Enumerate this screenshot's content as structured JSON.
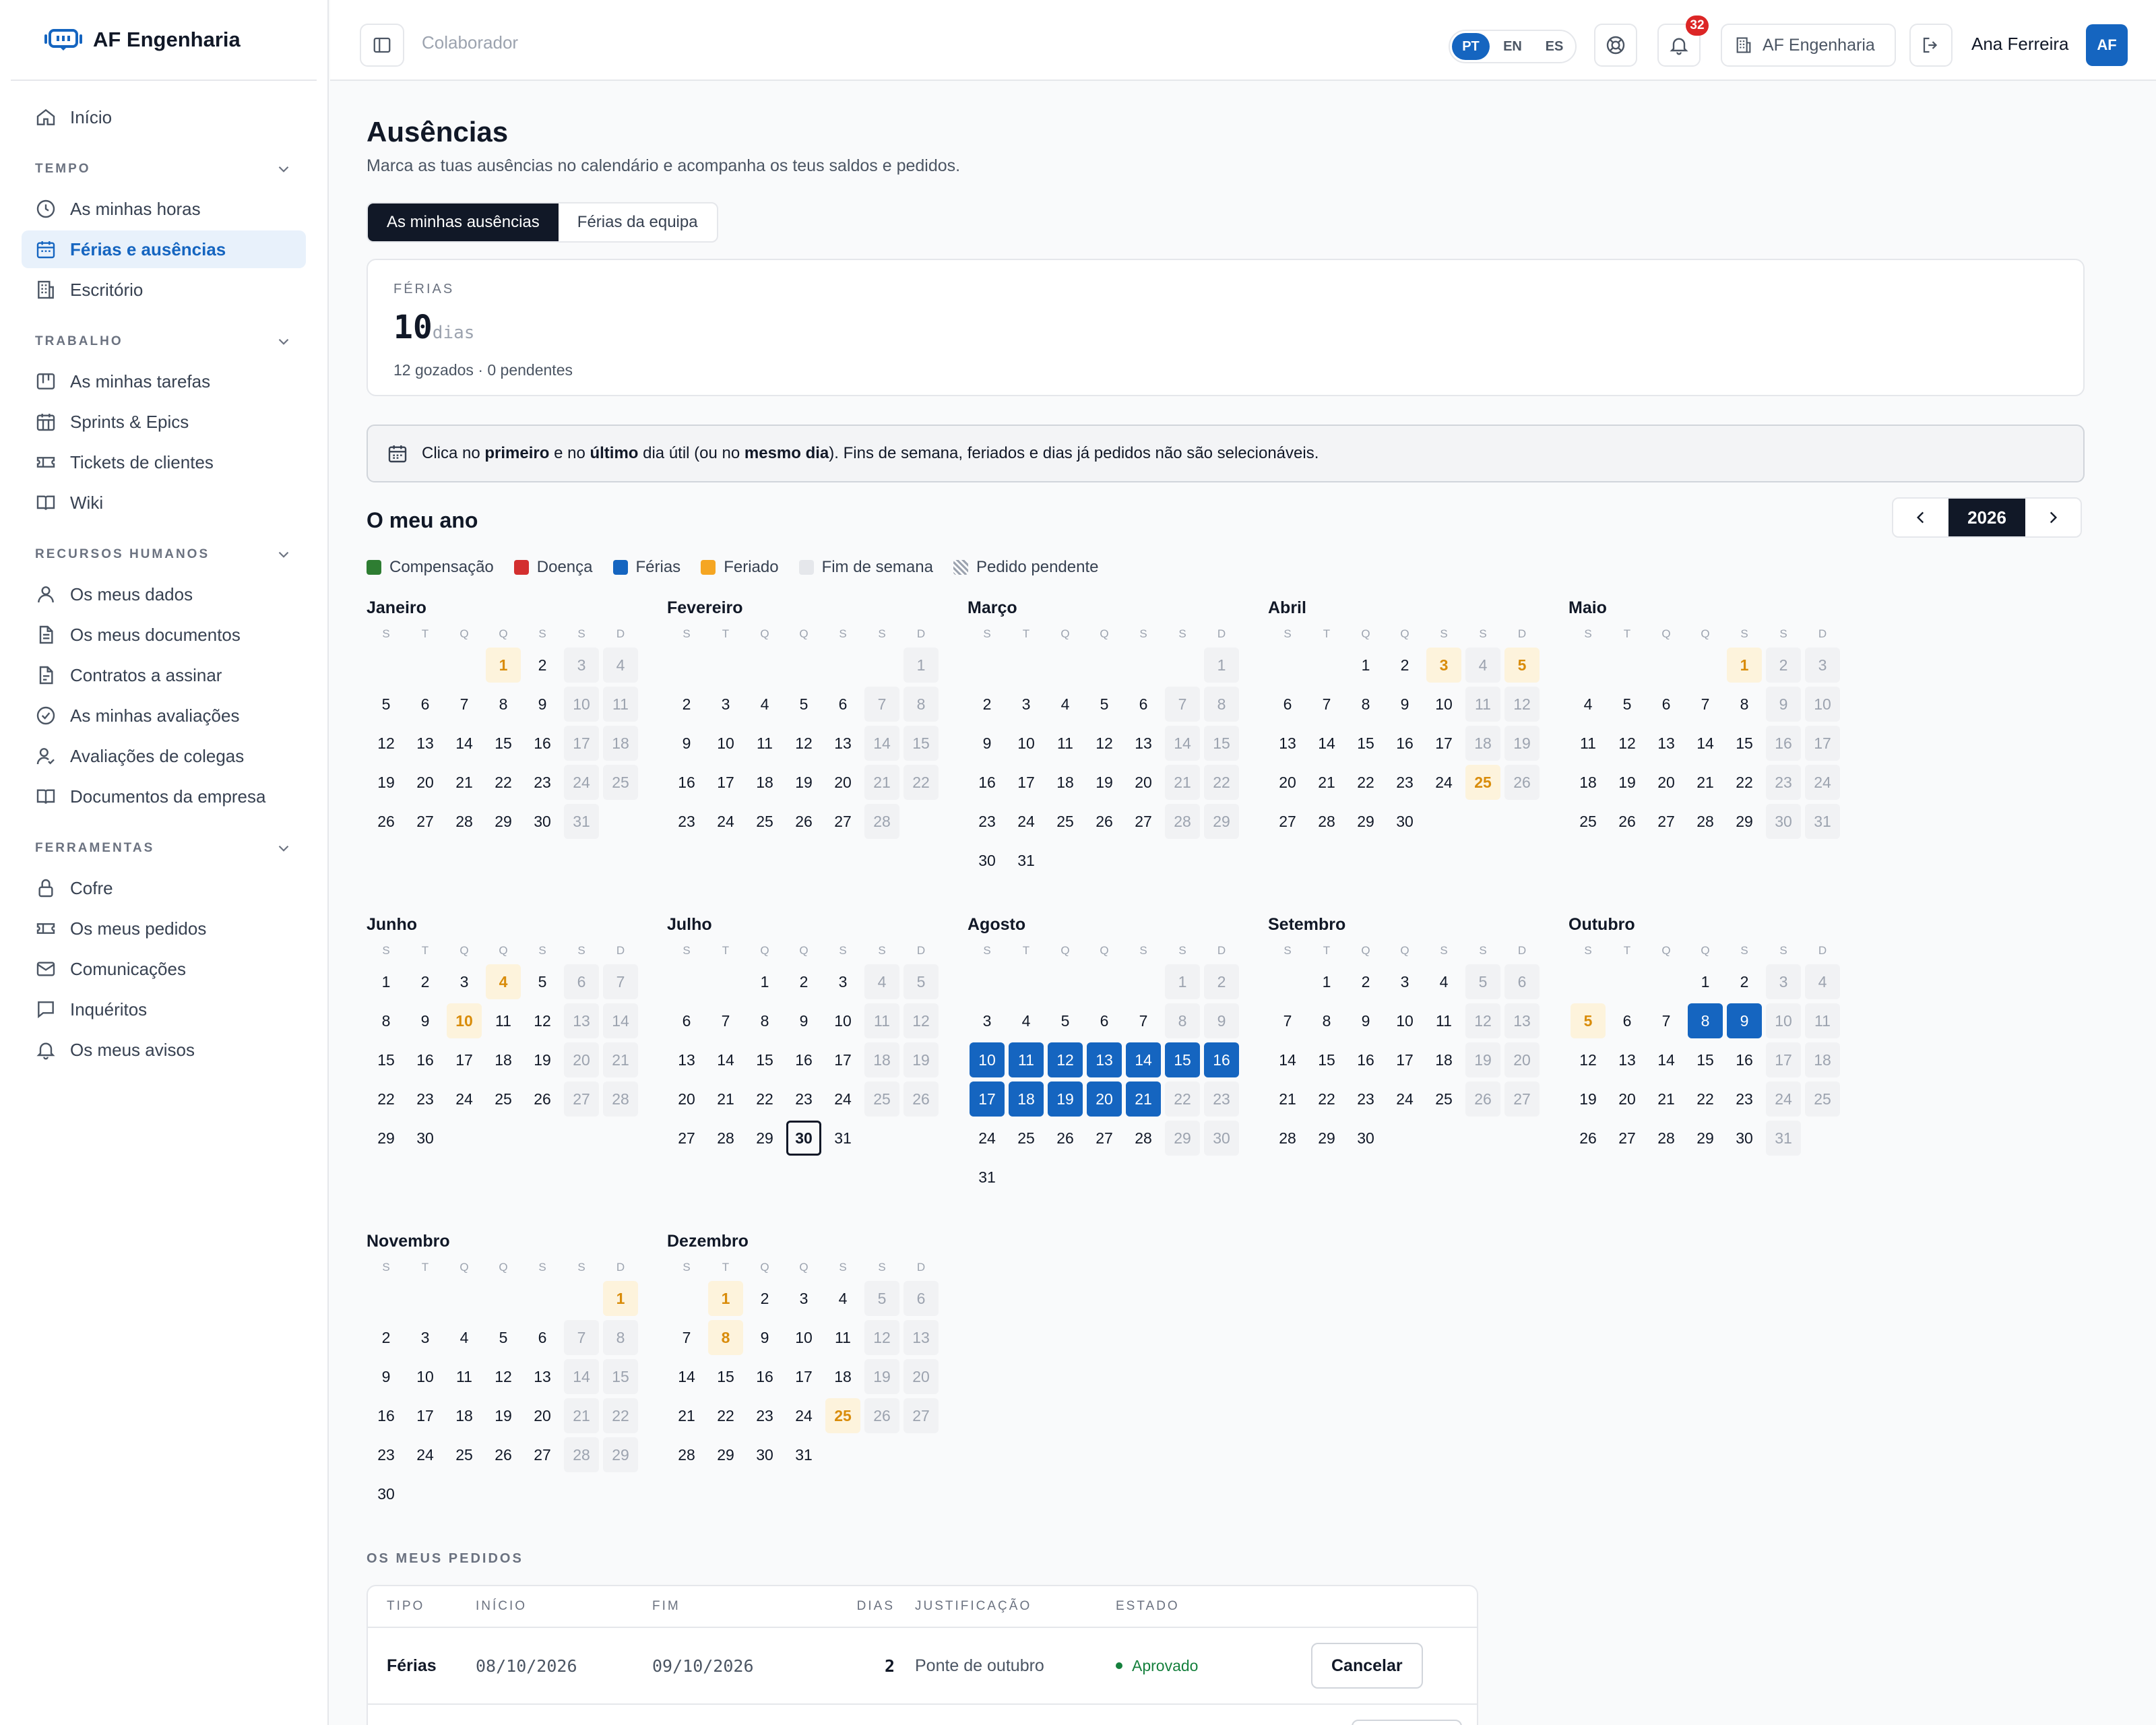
{
  "brand": {
    "name": "AF Engenharia"
  },
  "sidebar": {
    "home": "Início",
    "sections": [
      {
        "title": "TEMPO",
        "items": [
          {
            "label": "As minhas horas",
            "icon": "clock-icon"
          },
          {
            "label": "Férias e ausências",
            "icon": "calendar-icon",
            "active": true
          },
          {
            "label": "Escritório",
            "icon": "building-icon"
          }
        ]
      },
      {
        "title": "TRABALHO",
        "items": [
          {
            "label": "As minhas tarefas",
            "icon": "kanban-icon"
          },
          {
            "label": "Sprints & Epics",
            "icon": "calendar-grid-icon"
          },
          {
            "label": "Tickets de clientes",
            "icon": "ticket-icon"
          },
          {
            "label": "Wiki",
            "icon": "book-icon"
          }
        ]
      },
      {
        "title": "RECURSOS HUMANOS",
        "items": [
          {
            "label": "Os meus dados",
            "icon": "user-icon"
          },
          {
            "label": "Os meus documentos",
            "icon": "document-icon"
          },
          {
            "label": "Contratos a assinar",
            "icon": "document-sign-icon"
          },
          {
            "label": "As minhas avaliações",
            "icon": "check-circle-icon"
          },
          {
            "label": "Avaliações de colegas",
            "icon": "user-check-icon"
          },
          {
            "label": "Documentos da empresa",
            "icon": "book-icon"
          }
        ]
      },
      {
        "title": "FERRAMENTAS",
        "items": [
          {
            "label": "Cofre",
            "icon": "lock-icon"
          },
          {
            "label": "Os meus pedidos",
            "icon": "ticket-icon"
          },
          {
            "label": "Comunicações",
            "icon": "mail-icon"
          },
          {
            "label": "Inquéritos",
            "icon": "chat-icon"
          },
          {
            "label": "Os meus avisos",
            "icon": "bell-icon"
          }
        ]
      }
    ]
  },
  "header": {
    "breadcrumb": "Colaborador",
    "languages": [
      "PT",
      "EN",
      "ES"
    ],
    "active_language": "PT",
    "notifications": "32",
    "company": "AF Engenharia",
    "user": "Ana Ferreira",
    "initials": "AF"
  },
  "page": {
    "title": "Ausências",
    "subtitle": "Marca as tuas ausências no calendário e acompanha os teus saldos e pedidos.",
    "tabs": [
      "As minhas ausências",
      "Férias da equipa"
    ]
  },
  "balance": {
    "label": "FÉRIAS",
    "value": "10",
    "unit": "dias",
    "detail": "12 gozados · 0 pendentes"
  },
  "info": {
    "t1": "Clica no ",
    "b1": "primeiro",
    "t2": " e no ",
    "b2": "último",
    "t3": " dia útil (ou no ",
    "b3": "mesmo dia",
    "t4": "). Fins de semana, feriados e dias já pedidos não são selecionáveis."
  },
  "calendar": {
    "title": "O meu ano",
    "year": "2026",
    "weekdays": [
      "S",
      "T",
      "Q",
      "Q",
      "S",
      "S",
      "D"
    ],
    "legend": [
      {
        "label": "Compensação",
        "color": "#2e7d32"
      },
      {
        "label": "Doença",
        "color": "#d32f2f"
      },
      {
        "label": "Férias",
        "color": "#1565c0"
      },
      {
        "label": "Feriado",
        "color": "#f5a623"
      },
      {
        "label": "Fim de semana",
        "color": "#e5e7eb"
      },
      {
        "label": "Pedido pendente",
        "color": "hatched"
      }
    ],
    "months": [
      {
        "name": "Janeiro",
        "offset": 3,
        "days": 31,
        "holidays": [
          1
        ],
        "vacation": []
      },
      {
        "name": "Fevereiro",
        "offset": 6,
        "days": 28,
        "holidays": [],
        "vacation": []
      },
      {
        "name": "Março",
        "offset": 6,
        "days": 31,
        "holidays": [],
        "vacation": []
      },
      {
        "name": "Abril",
        "offset": 2,
        "days": 30,
        "holidays": [
          3,
          5,
          25
        ],
        "vacation": []
      },
      {
        "name": "Maio",
        "offset": 4,
        "days": 31,
        "holidays": [
          1
        ],
        "vacation": []
      },
      {
        "name": "Junho",
        "offset": 0,
        "days": 30,
        "holidays": [
          4,
          10
        ],
        "vacation": []
      },
      {
        "name": "Julho",
        "offset": 2,
        "days": 31,
        "holidays": [],
        "vacation": [],
        "today": 30
      },
      {
        "name": "Agosto",
        "offset": 5,
        "days": 31,
        "holidays": [],
        "vacation": [
          10,
          11,
          12,
          13,
          14,
          15,
          16,
          17,
          18,
          19,
          20,
          21
        ]
      },
      {
        "name": "Setembro",
        "offset": 1,
        "days": 30,
        "holidays": [],
        "vacation": []
      },
      {
        "name": "Outubro",
        "offset": 3,
        "days": 31,
        "holidays": [
          5
        ],
        "vacation": [
          8,
          9
        ]
      },
      {
        "name": "Novembro",
        "offset": 6,
        "days": 30,
        "holidays": [
          1
        ],
        "vacation": []
      },
      {
        "name": "Dezembro",
        "offset": 1,
        "days": 31,
        "holidays": [
          1,
          8,
          25
        ],
        "vacation": []
      }
    ]
  },
  "requests": {
    "title": "OS MEUS PEDIDOS",
    "columns": [
      "TIPO",
      "INÍCIO",
      "FIM",
      "DIAS",
      "JUSTIFICAÇÃO",
      "ESTADO"
    ],
    "rows": [
      {
        "type": "Férias",
        "start": "08/10/2026",
        "end": "09/10/2026",
        "days": "2",
        "reason": "Ponte de outubro",
        "status": "Aprovado",
        "action": "Cancelar"
      }
    ]
  }
}
